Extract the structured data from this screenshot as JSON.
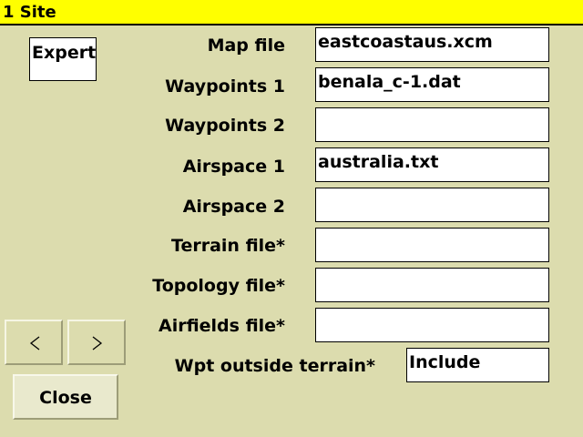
{
  "window": {
    "title": "1 Site"
  },
  "expert_toggle": {
    "label": "Expert"
  },
  "fields": [
    {
      "label": "Map file",
      "value": "eastcoastaus.xcm"
    },
    {
      "label": "Waypoints 1",
      "value": "benala_c-1.dat"
    },
    {
      "label": "Waypoints 2",
      "value": ""
    },
    {
      "label": "Airspace 1",
      "value": "australia.txt"
    },
    {
      "label": "Airspace 2",
      "value": ""
    },
    {
      "label": "Terrain file*",
      "value": ""
    },
    {
      "label": "Topology file*",
      "value": ""
    },
    {
      "label": "Airfields file*",
      "value": ""
    }
  ],
  "wpt_outside_terrain": {
    "label": "Wpt outside terrain*",
    "value": "Include"
  },
  "nav": {
    "prev_icon": "chevron-left-icon",
    "next_icon": "chevron-right-icon"
  },
  "close_button": {
    "label": "Close"
  },
  "colors": {
    "title_bar": "#ffff00",
    "background": "#dcdcae",
    "field": "#ffffff"
  }
}
